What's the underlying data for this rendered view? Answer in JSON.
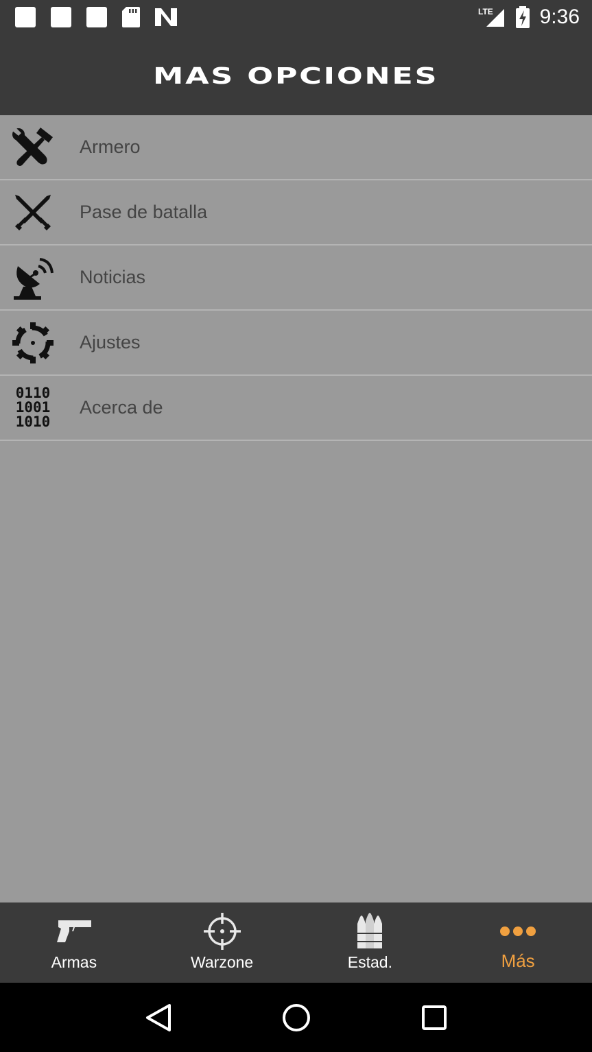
{
  "status_bar": {
    "time": "9:36",
    "network": "LTE"
  },
  "header": {
    "title": "MAS OPCIONES"
  },
  "menu": {
    "items": [
      {
        "label": "Armero",
        "icon": "tools-icon"
      },
      {
        "label": "Pase de batalla",
        "icon": "crossed-swords-icon"
      },
      {
        "label": "Noticias",
        "icon": "satellite-dish-icon"
      },
      {
        "label": "Ajustes",
        "icon": "gear-icon"
      },
      {
        "label": "Acerca de",
        "icon": "binary-code-icon",
        "icon_text": [
          "0110",
          "1001",
          "1010"
        ]
      }
    ]
  },
  "bottom_nav": {
    "items": [
      {
        "label": "Armas",
        "icon": "pistol-icon"
      },
      {
        "label": "Warzone",
        "icon": "crosshair-icon"
      },
      {
        "label": "Estad.",
        "icon": "bullets-icon"
      },
      {
        "label": "Más",
        "icon": "more-dots-icon",
        "active": true
      }
    ]
  },
  "colors": {
    "background": "#9a9a9a",
    "bar": "#3a3a3a",
    "accent": "#f0a040",
    "label": "#444444"
  }
}
